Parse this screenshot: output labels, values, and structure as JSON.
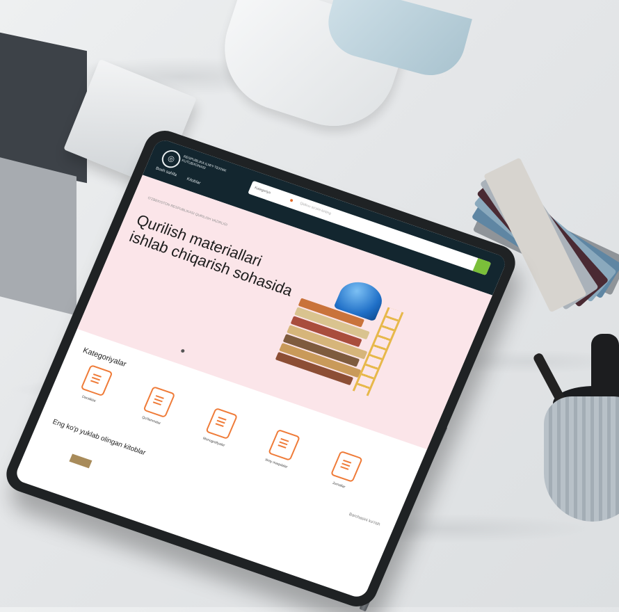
{
  "site": {
    "logo_text": "RESPUBLIKA ILMIY-TEXNIK KUTUBXONASI",
    "nav": [
      "Bosh sahifa",
      "Kitoblar"
    ],
    "search": {
      "category": "Kategoriya",
      "placeholder": "Qidiruv so'zini kiriting"
    }
  },
  "hero": {
    "small_text": "O'ZBEKISTON RESPUBLIKASI QURILISH VAZIRLIGI",
    "title_line1": "Qurilish materiallari",
    "title_line2": "ishlab chiqarish sohasida"
  },
  "categories": {
    "title": "Kategoriyalar",
    "items": [
      "Darsliklar",
      "Qo'llanmalar",
      "Monografiyalar",
      "Ilmiy maqolalar",
      "Jurnallar"
    ]
  },
  "popular": {
    "title": "Eng ko'p yuklab olingan kitoblar",
    "see_all": "Barchasini ko'rish"
  },
  "colors": {
    "header": "#13262f",
    "accent": "#ef7b38",
    "search_button": "#7bbf3a",
    "hero_bg": "#fbe5e9"
  }
}
